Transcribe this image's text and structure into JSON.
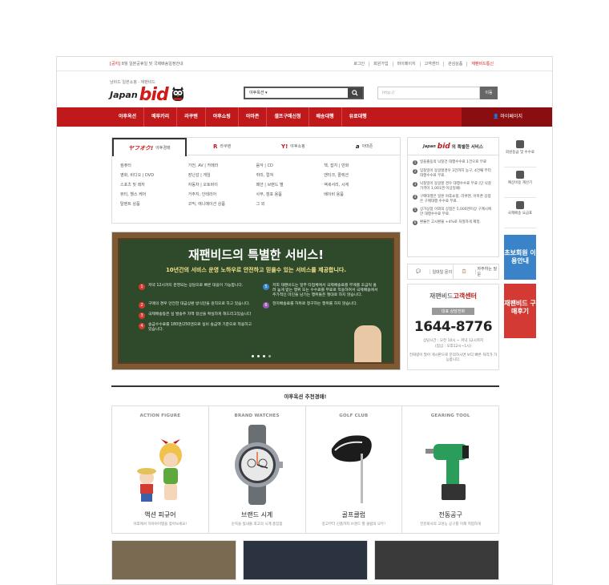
{
  "topbar": {
    "notice_red": "[공지]",
    "notice": " 8월 일본공휴일 및 국제배송일정안내",
    "links": [
      "로그인",
      "회원가입",
      "마이페이지",
      "고객센터",
      "관심상품"
    ],
    "link_red": "재팬비드통신"
  },
  "brand": {
    "tagline": "냠비드 일본쇼핑 · 재팬비드",
    "logo_jp": "Japan",
    "logo_bid": "bid"
  },
  "search": {
    "select": "야후옥션",
    "url_placeholder": "http://",
    "go": "이동"
  },
  "nav": {
    "items": [
      "야후옥션",
      "메루카리",
      "라쿠텐",
      "야후쇼핑",
      "아마존",
      "셀프구매신청",
      "배송대행",
      "유료대행"
    ],
    "mypage": "마이페이지"
  },
  "tabs": [
    {
      "label": "야후경매",
      "logo": "ヤフオク!"
    },
    {
      "label": "라쿠텐",
      "logo": "R"
    },
    {
      "label": "야후쇼핑",
      "logo": "Y!"
    },
    {
      "label": "아마존",
      "logo": "a"
    }
  ],
  "categories": [
    "컴퓨터",
    "가전, AV | 카메라",
    "음악 | CD",
    "책, 잡지 | 만화",
    "영화, 비디오 | DVD",
    "장난감 | 게임",
    "취미, 컬쳐",
    "앤티크, 콜렉션",
    "스포츠 및 레저",
    "자동차 | 오토바이",
    "패션 | 브랜드 별",
    "액세서리, 시계",
    "뷰티, 헬스 케어",
    "거주지, 인테리어",
    "사무, 점포 용품",
    "베이비 용품",
    "탈렌트 상품",
    "코믹, 애니메이션 상품",
    "그 외"
  ],
  "banner": {
    "title": "재팬비드의 특별한 서비스!",
    "subtitle": "10년간의 서비스 운영 노하우로 안전하고 믿을수 있는 서비스를 제공합니다.",
    "items": [
      {
        "n": "1",
        "text": "저녁 12시까지 운영되는 상담으로 빠른 대응이 가능합니다."
      },
      {
        "n": "5",
        "text": "저희 재팬비드는 일부 타업체에서 국제배송료를 무게를 조금씩 올려 높게 받는 행위 또는 수수료를 무료로 적용하여서 국제배송에서 추가적인 마진을 남기는 행위들은 절대로 하지 않습니다."
      },
      {
        "n": "2",
        "text": "구매의 경우 안전한 대금상환 방식만을 원칙으로 하고 있습니다."
      },
      {
        "n": "6",
        "text": "현지배송료를 허위로 청구하는 행위를 하지 않습니다."
      },
      {
        "n": "3",
        "text": "국제배송등은 실 발송주 차액 정산을 확실하게 해드리고있습니다"
      },
      {
        "n": "",
        "text": ""
      },
      {
        "n": "4",
        "text": "송금수수료를 180엔/250엔으로 실비 송금액 기준으로 적용하고 있습니다."
      }
    ]
  },
  "special": {
    "logo_jp": "Japan",
    "logo_bid": "bid",
    "title": "의 특별한 서비스",
    "items": [
      "일을출동의 낙찰건 대행수수료 1건으로 무료",
      "입찰일이 동일할경우 3건까지 농구, 4건째 부터 대행수수료 무료.",
      "낙찰일이 동일할 경우 대행수수료 무료 (단 낙찰가격이 1,001엔 이상일때)",
      "구매대행은 일본 야후쇼핑, 라쿠텐, 아마존 상점은 구매대행 수수료 무료.",
      "상가상점 이외의 상점은 5,000엔이상 구매시에만 대행수수료 무료.",
      "환불은 고시환율 +4%로 처절하게 제정."
    ]
  },
  "cta": {
    "a": "일대일 문의",
    "b": "자주하는 질문"
  },
  "cs": {
    "title1": "재팬비드",
    "title2": "고객센터",
    "tag": "대표 상담전화",
    "phone": "1644-8776",
    "hours": "상담시간 : 오전 10시 ~ 저녁 12시까지",
    "hours2": "(점심 : 오후12시~1시)",
    "note": "전화량이 많아 게시판으로 문의하시면 보다 빠른 처리가 가능합니다."
  },
  "quick": [
    {
      "label": "회원등급 및 수수료"
    },
    {
      "label": "예상비용 계산기"
    },
    {
      "label": "국제배송 요금표"
    }
  ],
  "side_banners": {
    "b1": "초보회원 이용안내",
    "b2": "재팬비드 구매후기"
  },
  "recommend": {
    "title": "야후옥션 추천경매!",
    "cards": [
      {
        "cat": "ACTION FIGURE",
        "name": "액션 피규어",
        "desc": "야후에서 하야야이템을 찾아보세요!"
      },
      {
        "cat": "BRAND WATCHES",
        "name": "브랜드 시계",
        "desc": "순목을 빛내줄 최고의 시계 총집합"
      },
      {
        "cat": "GOLF CLUB",
        "name": "골프클럽",
        "desc": "중고부터 신품까지 브랜드 별 클럽의 모두!"
      },
      {
        "cat": "GEARING TOOL",
        "name": "전동공구",
        "desc": "전문회사의 고성능 공구를 이제 저렴하게"
      }
    ]
  }
}
